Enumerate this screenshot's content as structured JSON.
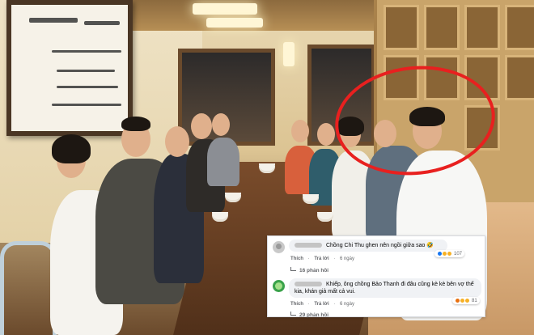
{
  "comments": [
    {
      "text": "Chồng Chi Thu ghen nên ngồi giữa sao 🤣",
      "actions": {
        "like": "Thích",
        "reply": "Trả lời",
        "time": "6 ngày"
      },
      "reactions_count": "107",
      "replies_label": "16 phản hồi"
    },
    {
      "text": "Khiếp, ông chồng Bảo Thanh đi đâu cũng kè kè bên vợ thế kia, khán giả mất cả vui.",
      "actions": {
        "like": "Thích",
        "reply": "Trả lời",
        "time": "6 ngày"
      },
      "reactions_count": "81",
      "replies_label": "29 phản hồi"
    }
  ],
  "colors": {
    "highlight": "#e8201f",
    "fb_gray": "#65676b",
    "bubble": "#f0f2f5"
  },
  "icons": [
    "user-avatar-icon",
    "reaction-like-icon",
    "reaction-haha-icon",
    "reaction-wow-icon",
    "reaction-angry-icon",
    "reply-arrow-icon"
  ]
}
